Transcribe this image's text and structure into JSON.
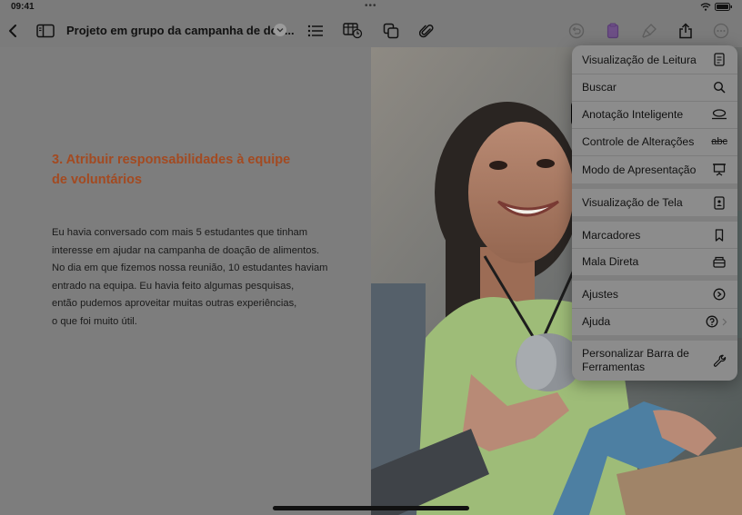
{
  "status_bar": {
    "time": "09:41",
    "dots": "•••"
  },
  "toolbar": {
    "doc_title": "Projeto em grupo da campanha de doa...",
    "icons": [
      "back-icon",
      "sidebar-icon",
      "chevron-down-icon",
      "list-icon",
      "table-icon",
      "copy-icon",
      "paperclip-icon",
      "undo-icon",
      "clipboard-icon",
      "brush-icon",
      "share-icon",
      "more-icon"
    ]
  },
  "document": {
    "heading_line1": "3. Atribuir responsabilidades à equipe",
    "heading_line2": "de voluntários",
    "body_lines": [
      "Eu havia conversado com mais 5 estudantes que tinham",
      "interesse em ajudar na campanha de doação de alimentos.",
      "No dia em que fizemos nossa reunião, 10 estudantes haviam",
      "entrado na equipa. Eu havia feito algumas pesquisas,",
      "então pudemos aproveitar muitas outras experiências,",
      "o que foi muito útil."
    ]
  },
  "menu": {
    "items": [
      {
        "label": "Visualização de Leitura",
        "icon": "reader-icon"
      },
      {
        "label": "Buscar",
        "icon": "search-icon"
      },
      {
        "label": "Anotação Inteligente",
        "icon": "smart-annotation-icon"
      },
      {
        "label": "Controle de Alterações",
        "icon": "track-changes-icon",
        "icon_text": "abc"
      },
      {
        "label": "Modo de Apresentação",
        "icon": "presentation-icon"
      },
      {
        "label": "Visualização de Tela",
        "icon": "screen-view-icon"
      },
      {
        "label": "Marcadores",
        "icon": "bookmark-icon"
      },
      {
        "label": "Mala Direta",
        "icon": "mail-merge-icon"
      },
      {
        "label": "Ajustes",
        "icon": "settings-icon"
      },
      {
        "label": "Ajuda",
        "icon": "help-icon"
      },
      {
        "label_line1": "Personalizar Barra de",
        "label_line2": "Ferramentas",
        "icon": "wrench-icon"
      }
    ],
    "selected_index": 2
  },
  "colors": {
    "accent_heading": "#a34a21",
    "menu_bg": "#8c8c8c",
    "selected_bg": "#f3f3f3"
  }
}
